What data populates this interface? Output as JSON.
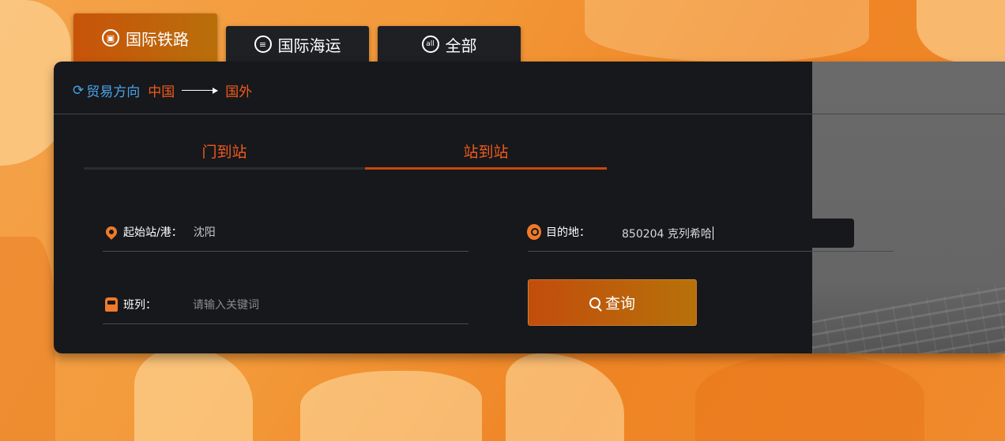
{
  "tabs": [
    {
      "label": "国际铁路",
      "icon": "train-icon",
      "active": true
    },
    {
      "label": "国际海运",
      "icon": "ship-icon",
      "active": false
    },
    {
      "label": "全部",
      "icon": "all-icon",
      "active": false
    }
  ],
  "all_icon_text": "all",
  "direction": {
    "label": "贸易方向",
    "from": "中国",
    "to": "国外"
  },
  "mode_tabs": [
    {
      "label": "门到站",
      "active": false
    },
    {
      "label": "站到站",
      "active": true
    }
  ],
  "form": {
    "origin": {
      "label": "起始站/港：",
      "value": "沈阳"
    },
    "destination": {
      "label": "目的地：",
      "value": "850204 克列希哈"
    },
    "train": {
      "label": "班列：",
      "placeholder": "请输入关键词"
    },
    "search_label": "查询"
  },
  "colors": {
    "accent": "#f05a1e",
    "direction_blue": "#4aa3e8",
    "panel_bg": "#17181b"
  }
}
